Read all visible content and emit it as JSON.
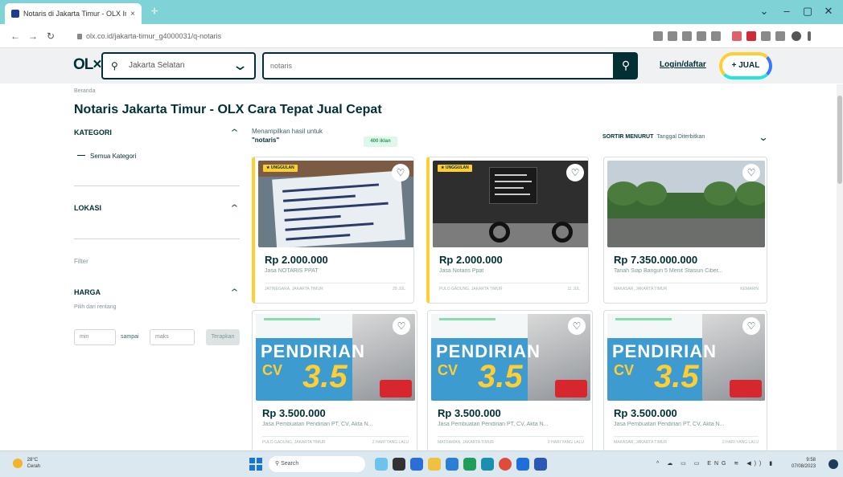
{
  "browser": {
    "tab_title": "Notaris di Jakarta Timur - OLX Ind...",
    "tab_close": "×",
    "new_tab": "+",
    "url": "olx.co.id/jakarta-timur_g4000031/q-notaris",
    "window_controls": [
      "⌄",
      "–",
      "▢",
      "✕"
    ]
  },
  "header": {
    "logo": "OL×",
    "location_value": "Jakarta Selatan",
    "search_placeholder": "notaris",
    "login_label": "Login/daftar",
    "sell_label": "+ JUAL"
  },
  "page": {
    "breadcrumb": "Beranda",
    "title": "Notaris Jakarta Timur - OLX Cara Tepat Jual Cepat"
  },
  "sidebar": {
    "category_header": "KATEGORI",
    "category_all": "Semua Kategori",
    "location_header": "LOKASI",
    "filter_label": "Filter",
    "price_header": "HARGA",
    "price_hint": "Pilih dari rentang",
    "price_min_placeholder": "min",
    "price_to": "sampai",
    "price_max_placeholder": "maks",
    "apply_label": "Terapkan"
  },
  "results": {
    "summary_line1": "Menampilkan hasil untuk",
    "summary_query": "\"notaris\"",
    "count_badge": "400 iklan",
    "sort_label": "SORTIR MENURUT",
    "sort_value": "Tanggal Diterbitkan"
  },
  "listings": [
    {
      "price": "Rp 2.000.000",
      "title": "Jasa NOTARIS PPAT",
      "location": "JATINEGARA, JAKARTA TIMUR",
      "date": "29 JUL",
      "badge": "★ UNGGULAN",
      "image": "notes"
    },
    {
      "price": "Rp 2.000.000",
      "title": "Jasa Notaris Ppat",
      "location": "PULO GADUNG, JAKARTA TIMUR",
      "date": "11 JUL",
      "badge": "★ UNGGULAN",
      "image": "moto"
    },
    {
      "price": "Rp 7.350.000.000",
      "title": "Tanah Siap Bangun 5 Menit Stasiun Ciber...",
      "location": "MAKASAR, JAKARTA TIMUR",
      "date": "KEMARIN",
      "badge": "",
      "image": "land"
    },
    {
      "price": "Rp 3.500.000",
      "title": "Jasa Pembuatan Pendirian PT, CV, Akta N...",
      "location": "PULO GADUNG, JAKARTA TIMUR",
      "date": "2 HARI YANG LALU",
      "badge": "",
      "image": "cv"
    },
    {
      "price": "Rp 3.500.000",
      "title": "Jasa Pembuatan Pendirian PT, CV, Akta N...",
      "location": "MATRAMAN, JAKARTA TIMUR",
      "date": "2 HARI YANG LALU",
      "badge": "",
      "image": "cv"
    },
    {
      "price": "Rp 3.500.000",
      "title": "Jasa Pembuatan Pendirian PT, CV, Akta N...",
      "location": "MAKASAR, JAKARTA TIMUR",
      "date": "2 HARI YANG LALU",
      "badge": "",
      "image": "cv"
    }
  ],
  "promo": {
    "headline": "PENDIRIAN",
    "cv": "CV",
    "number": "3.5"
  },
  "taskbar": {
    "weather_temp": "28°C",
    "weather_desc": "Cerah",
    "search_label": "Search",
    "tray": "^ ☁ ▭ ▭ ENG ≋ ◀)) ▮",
    "time": "9:58",
    "date": "07/08/2023"
  },
  "colors": {
    "brand_dark": "#002f34",
    "tabbar": "#7fd3d7",
    "featured_yellow": "#ffce32",
    "sell_blue": "#3a77ff",
    "sell_teal": "#23e5db"
  }
}
